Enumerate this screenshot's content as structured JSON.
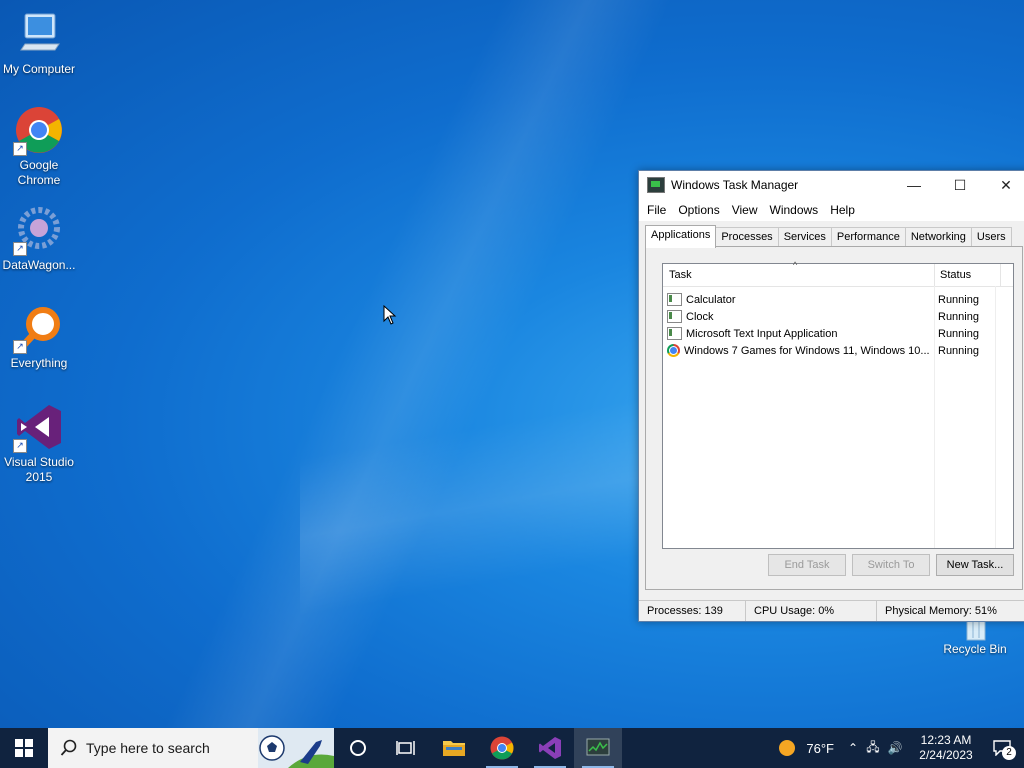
{
  "desktop": {
    "icons": [
      {
        "label": "My Computer"
      },
      {
        "label": "Google Chrome"
      },
      {
        "label": "DataWagon..."
      },
      {
        "label": "Everything"
      },
      {
        "label": "Visual Studio 2015"
      }
    ],
    "recycle_bin": "Recycle Bin"
  },
  "task_manager": {
    "title": "Windows Task Manager",
    "menu": [
      "File",
      "Options",
      "View",
      "Windows",
      "Help"
    ],
    "tabs": [
      "Applications",
      "Processes",
      "Services",
      "Performance",
      "Networking",
      "Users"
    ],
    "columns": {
      "task": "Task",
      "status": "Status"
    },
    "rows": [
      {
        "task": "Calculator",
        "status": "Running"
      },
      {
        "task": "Clock",
        "status": "Running"
      },
      {
        "task": "Microsoft Text Input Application",
        "status": "Running"
      },
      {
        "task": "Windows 7 Games for Windows 11, Windows 10...",
        "status": "Running"
      }
    ],
    "buttons": {
      "end_task": "End Task",
      "switch_to": "Switch To",
      "new_task": "New Task..."
    },
    "status": {
      "processes": "Processes: 139",
      "cpu": "CPU Usage: 0%",
      "memory": "Physical Memory: 51%"
    }
  },
  "taskbar": {
    "search_placeholder": "Type here to search",
    "weather": "76°F",
    "time": "12:23 AM",
    "date": "2/24/2023",
    "notification_count": "2"
  }
}
